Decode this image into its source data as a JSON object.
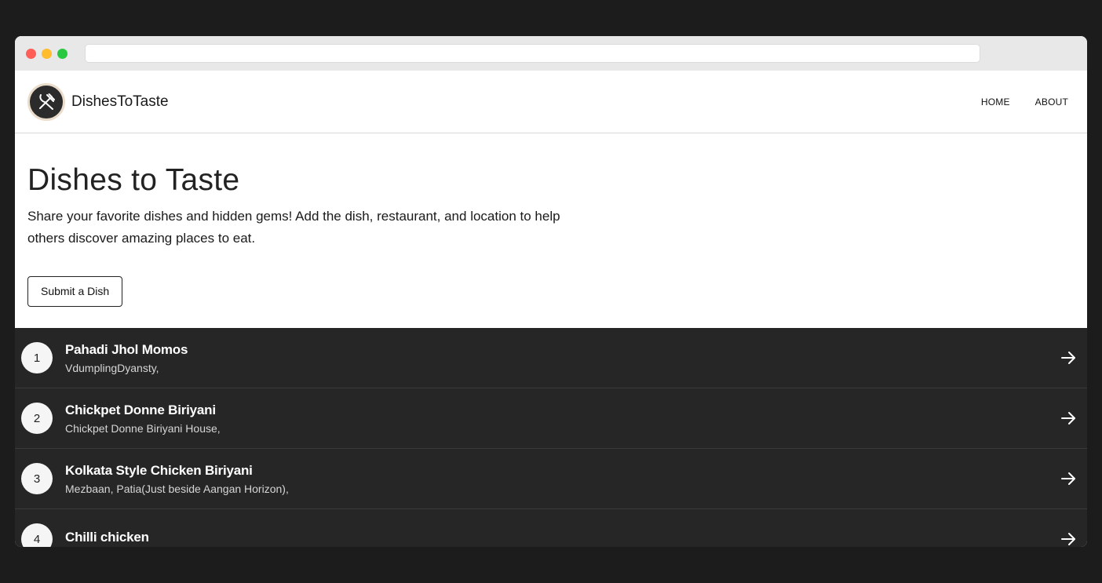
{
  "brand": {
    "name": "DishesToTaste",
    "logo_icon": "fork-knife-icon"
  },
  "nav": {
    "home": "HOME",
    "about": "ABOUT"
  },
  "hero": {
    "title": "Dishes to Taste",
    "description": "Share your favorite dishes and hidden gems! Add the dish, restaurant, and location to help others discover amazing places to eat.",
    "submit_label": "Submit a Dish"
  },
  "dishes": [
    {
      "rank": "1",
      "name": "Pahadi Jhol Momos",
      "place": "VdumplingDyansty,"
    },
    {
      "rank": "2",
      "name": "Chickpet Donne Biriyani",
      "place": "Chickpet Donne Biriyani House,"
    },
    {
      "rank": "3",
      "name": "Kolkata Style Chicken Biriyani",
      "place": "Mezbaan, Patia(Just beside Aangan Horizon),"
    },
    {
      "rank": "4",
      "name": "Chilli chicken",
      "place": ""
    }
  ],
  "colors": {
    "background": "#1c1c1c",
    "list_background": "#262626",
    "logo_background": "#2b2b2b",
    "logo_ring": "#e9dccb"
  }
}
